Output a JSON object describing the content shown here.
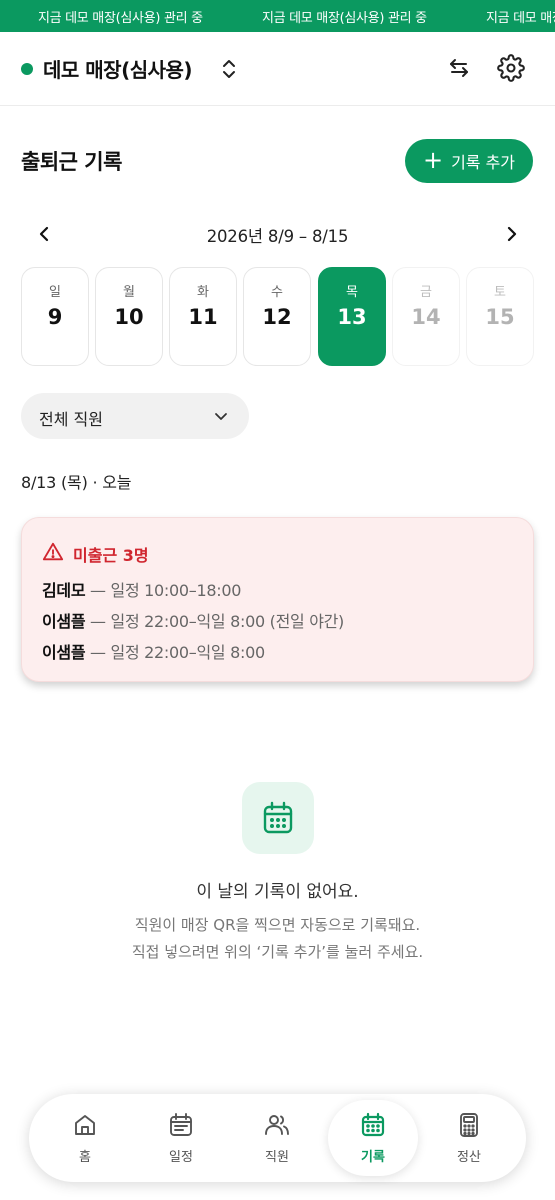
{
  "banner": {
    "message": "지금 데모 매장(심사용) 관리 중"
  },
  "header": {
    "store_name": "데모 매장(심사용)"
  },
  "page": {
    "title": "출퇴근 기록",
    "add_button_label": "기록 추가"
  },
  "week": {
    "range_label": "2026년 8/9 – 8/15",
    "days": [
      {
        "day_name": "일",
        "date": "9",
        "state": "normal"
      },
      {
        "day_name": "월",
        "date": "10",
        "state": "normal"
      },
      {
        "day_name": "화",
        "date": "11",
        "state": "normal"
      },
      {
        "day_name": "수",
        "date": "12",
        "state": "normal"
      },
      {
        "day_name": "목",
        "date": "13",
        "state": "selected"
      },
      {
        "day_name": "금",
        "date": "14",
        "state": "future"
      },
      {
        "day_name": "토",
        "date": "15",
        "state": "future"
      }
    ]
  },
  "filter": {
    "selected": "전체 직원"
  },
  "date_label": "8/13 (목) · 오늘",
  "alert": {
    "title": "미출근 3명",
    "rows": [
      {
        "name": "김데모",
        "separator": " — ",
        "detail": "일정 10:00–18:00"
      },
      {
        "name": "이샘플",
        "separator": " — ",
        "detail": "일정 22:00–익일 8:00 (전일 야간)"
      },
      {
        "name": "이샘플",
        "separator": " — ",
        "detail": "일정 22:00–익일 8:00"
      }
    ]
  },
  "empty": {
    "title": "이 날의 기록이 없어요.",
    "desc_line1": "직원이 매장 QR을 찍으면 자동으로 기록돼요.",
    "desc_line2": "직접 넣으려면 위의 ‘기록 추가’를 눌러 주세요."
  },
  "nav": {
    "items": [
      {
        "label": "홈",
        "icon": "home-icon"
      },
      {
        "label": "일정",
        "icon": "calendar-icon"
      },
      {
        "label": "직원",
        "icon": "users-icon"
      },
      {
        "label": "기록",
        "icon": "calendar-grid-icon",
        "active": true
      },
      {
        "label": "정산",
        "icon": "calculator-icon"
      }
    ]
  },
  "colors": {
    "brand": "#0b9960",
    "alert_bg": "#fdeeee",
    "alert_text": "#d0262f"
  }
}
